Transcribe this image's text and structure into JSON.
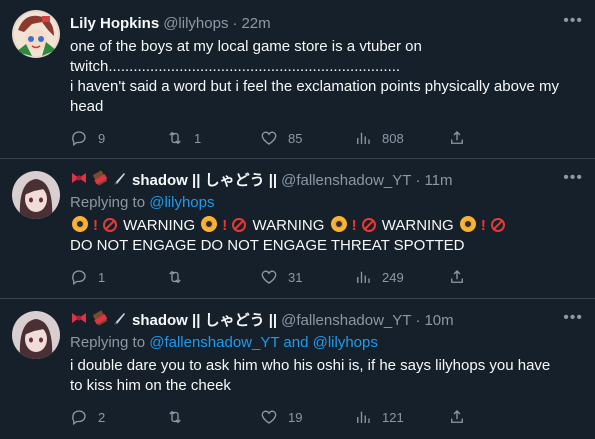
{
  "tweets": [
    {
      "name": "Lily Hopkins",
      "handle": "@lilyhops",
      "time": "22m",
      "lines": [
        "one of the boys at my local game store is a vtuber on",
        "twitch......................................................................",
        "i haven't said a word but i feel the exclamation points physically above my",
        "head"
      ],
      "replies": "9",
      "retweets": "1",
      "likes": "85",
      "views": "808"
    },
    {
      "name": "shadow || しゃどう ||",
      "handle": "@fallenshadow_YT",
      "time": "11m",
      "replying_prefix": "Replying to ",
      "replying_to": "@lilyhops",
      "warning_word": "WARNING",
      "line2": "DO NOT ENGAGE DO NOT ENGAGE THREAT SPOTTED",
      "replies": "1",
      "retweets": "",
      "likes": "31",
      "views": "249"
    },
    {
      "name": "shadow || しゃどう ||",
      "handle": "@fallenshadow_YT",
      "time": "10m",
      "replying_prefix": "Replying to ",
      "replying_to": "@fallenshadow_YT and @lilyhops",
      "lines": [
        "i double dare you to ask him who his oshi is, if he says lilyhops you have",
        "to kiss him on the cheek"
      ],
      "replies": "2",
      "retweets": "",
      "likes": "19",
      "views": "121"
    }
  ],
  "separator": "·",
  "more_glyph": "•••",
  "colors": {
    "background": "#15202b",
    "muted": "#8b98a5",
    "link": "#1d9bf0",
    "divider": "#38444d"
  }
}
